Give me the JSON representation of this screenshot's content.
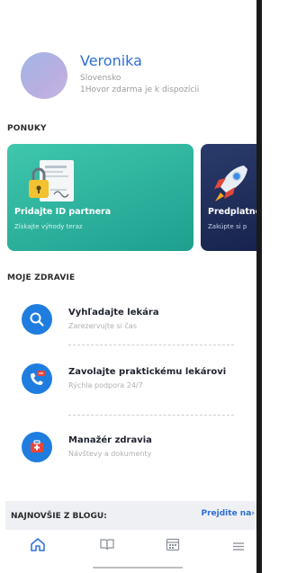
{
  "profile": {
    "name": "Veronika",
    "country": "Slovensko",
    "note": "1Hovor zdarma je k dispozícii"
  },
  "offers": {
    "title": "PONUKY",
    "cards": [
      {
        "title": "Pridajte ID partnera",
        "subtitle": "Získajte výhody teraz",
        "icon": "id-document-lock-icon"
      },
      {
        "title": "Predplatné",
        "subtitle": "Zakúpte si p",
        "icon": "rocket-icon"
      }
    ]
  },
  "health": {
    "title": "MOJE ZDRAVIE",
    "items": [
      {
        "title": "Vyhľadajte lekára",
        "subtitle": "Zarezervujte si čas",
        "icon": "search-icon"
      },
      {
        "title": "Zavolajte praktickému lekárovi",
        "subtitle": "Rýchla podpora 24/7",
        "icon": "phone-chat-icon"
      },
      {
        "title": "Manažér zdravia",
        "subtitle": "Návštevy a dokumenty",
        "icon": "medical-kit-icon"
      }
    ]
  },
  "blog": {
    "title": "NAJNOVŠIE Z BLOGU:",
    "link": "Prejdite na›"
  },
  "tabbar": {
    "tabs": [
      {
        "name": "home",
        "icon": "home-icon",
        "active": true
      },
      {
        "name": "library",
        "icon": "book-icon",
        "active": false
      },
      {
        "name": "calendar",
        "icon": "calendar-icon",
        "active": false
      },
      {
        "name": "menu",
        "icon": "menu-icon",
        "active": false
      }
    ]
  },
  "colors": {
    "accent": "#2f6fd6",
    "teal_card": "#27ad98",
    "navy_card": "#1b2855",
    "icon_blue": "#1f7de0",
    "icon_red": "#e8453c"
  }
}
